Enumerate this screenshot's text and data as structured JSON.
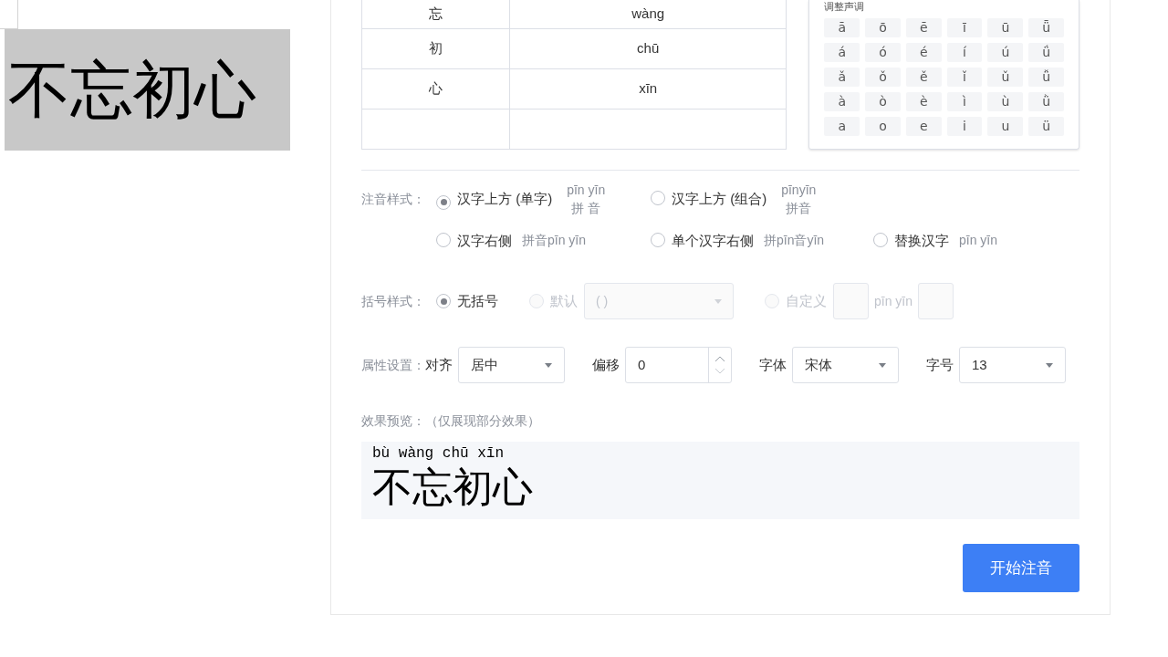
{
  "document": {
    "selected_text": "不忘初心"
  },
  "table": {
    "rows": [
      {
        "hanzi": "忘",
        "pinyin": "wàng"
      },
      {
        "hanzi": "初",
        "pinyin": "chū"
      },
      {
        "hanzi": "心",
        "pinyin": "xīn"
      }
    ]
  },
  "tone_panel": {
    "title": "调整声调",
    "keys": [
      [
        "ā",
        "ō",
        "ē",
        "ī",
        "ū",
        "ǖ"
      ],
      [
        "á",
        "ó",
        "é",
        "í",
        "ú",
        "ǘ"
      ],
      [
        "ǎ",
        "ǒ",
        "ě",
        "ǐ",
        "ǔ",
        "ǚ"
      ],
      [
        "à",
        "ò",
        "è",
        "ì",
        "ù",
        "ǜ"
      ],
      [
        "a",
        "o",
        "e",
        "i",
        "u",
        "ü"
      ]
    ]
  },
  "annotation_style": {
    "label": "注音样式：",
    "options": [
      {
        "kind": "stacked",
        "label": "汉字上方 (单字)",
        "sample_top": "pīn yīn",
        "sample_bottom": "拼 音",
        "selected": true
      },
      {
        "kind": "stacked",
        "label": "汉字上方 (组合)",
        "sample_top": "pīnyīn",
        "sample_bottom": "拼音",
        "selected": false
      },
      {
        "kind": "inline",
        "label": "汉字右侧",
        "sample": "拼音pīn yīn",
        "selected": false
      },
      {
        "kind": "inline",
        "label": "单个汉字右侧",
        "sample": "拼pīn音yīn",
        "selected": false
      },
      {
        "kind": "inline",
        "label": "替换汉字",
        "sample": "pīn yīn",
        "selected": false
      }
    ]
  },
  "bracket_style": {
    "label": "括号样式：",
    "options": [
      {
        "kind": "plain",
        "label": "无括号",
        "selected": true,
        "disabled": false
      },
      {
        "kind": "select",
        "label": "默认",
        "value": "( )",
        "selected": false,
        "disabled": true
      },
      {
        "kind": "custom",
        "label": "自定义",
        "between": "pīn yīn",
        "selected": false,
        "disabled": true
      }
    ]
  },
  "properties": {
    "label": "属性设置：",
    "fields": [
      {
        "kind": "select",
        "label": "对齐",
        "value": "居中"
      },
      {
        "kind": "number",
        "label": "偏移",
        "value": "0"
      },
      {
        "kind": "select",
        "label": "字体",
        "value": "宋体"
      },
      {
        "kind": "select",
        "label": "字号",
        "value": "13"
      }
    ]
  },
  "preview": {
    "label": "效果预览：（仅展现部分效果）",
    "pinyin": "bù wàng chū xīn",
    "text": "不忘初心"
  },
  "submit_button": "开始注音"
}
